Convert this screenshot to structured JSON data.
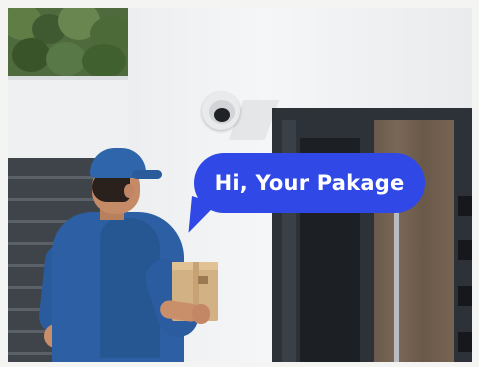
{
  "speech_bubble": {
    "text": "Hi, Your Pakage",
    "background_color": "#2f48e6",
    "text_color": "#ffffff"
  },
  "colors": {
    "uniform": "#2c5fa3",
    "door": "#2d3238",
    "door_wood": "#7a6757",
    "wall": "#f4f4f2"
  }
}
